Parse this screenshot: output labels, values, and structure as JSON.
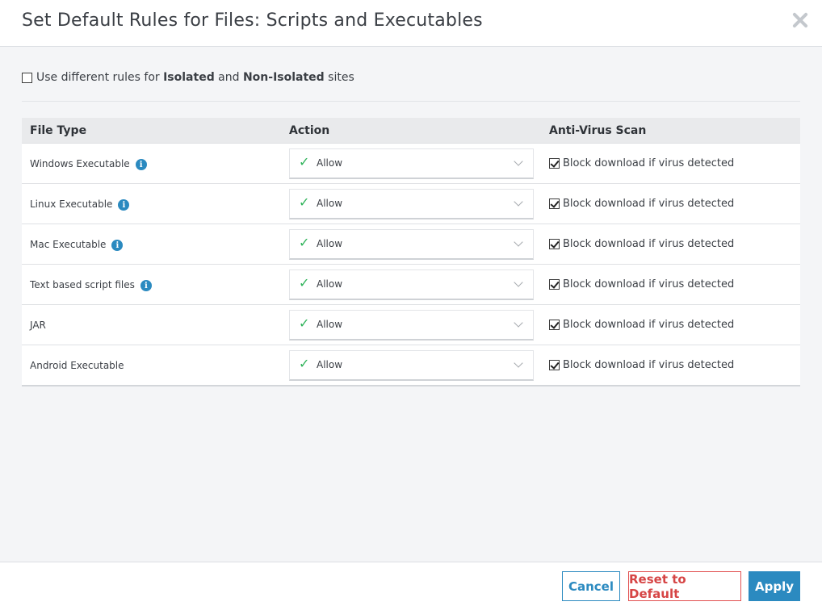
{
  "dialog": {
    "title": "Set Default Rules for Files: Scripts and Executables",
    "close_icon": "close-icon"
  },
  "option": {
    "checked": false,
    "prefix": "Use different rules for",
    "isolated": "Isolated",
    "and": "and",
    "non_isolated": "Non-Isolated",
    "suffix": "sites"
  },
  "table": {
    "headers": [
      "File Type",
      "Action",
      "Anti-Virus Scan"
    ],
    "rows": [
      {
        "file_type": "Windows Executable",
        "info": true,
        "action": "Allow",
        "av_label": "Block download if virus detected",
        "av_checked": true
      },
      {
        "file_type": "Linux Executable",
        "info": true,
        "action": "Allow",
        "av_label": "Block download if virus detected",
        "av_checked": true
      },
      {
        "file_type": "Mac Executable",
        "info": true,
        "action": "Allow",
        "av_label": "Block download if virus detected",
        "av_checked": true
      },
      {
        "file_type": "Text based script files",
        "info": true,
        "action": "Allow",
        "av_label": "Block download if virus detected",
        "av_checked": true
      },
      {
        "file_type": "JAR",
        "info": false,
        "action": "Allow",
        "av_label": "Block download if virus detected",
        "av_checked": true
      },
      {
        "file_type": "Android Executable",
        "info": false,
        "action": "Allow",
        "av_label": "Block download if virus detected",
        "av_checked": true
      }
    ]
  },
  "footer": {
    "cancel_label": "Cancel",
    "reset_label": "Reset to Default",
    "apply_label": "Apply"
  },
  "colors": {
    "accent": "#2b8ac0",
    "danger": "#d64545",
    "success": "#2fb35a"
  },
  "icons": {
    "info": "info-icon",
    "check": "check-icon",
    "dropdown": "chevron-down-icon"
  }
}
